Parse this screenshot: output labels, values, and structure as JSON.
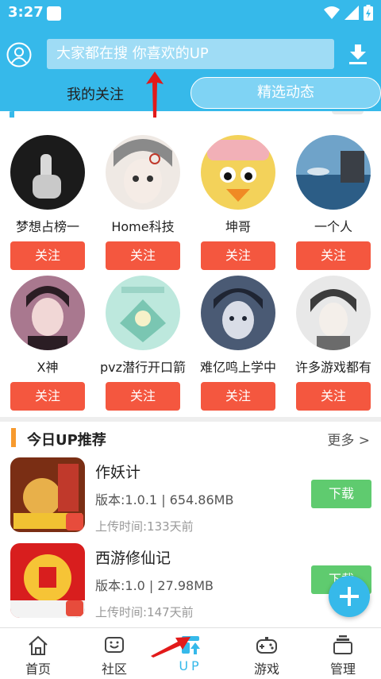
{
  "status_bar": {
    "time": "3:27"
  },
  "header": {
    "search_placeholder": "大家都在搜  你喜欢的UP",
    "tabs": [
      {
        "label": "我的关注"
      },
      {
        "label": "精选动态"
      }
    ]
  },
  "colors": {
    "accent": "#36b9ea",
    "follow": "#f4573f",
    "download": "#5fcb6f",
    "section_bar": "#f79a2e"
  },
  "up_list": {
    "follow_label": "关注",
    "items": [
      {
        "name": "梦想占榜一"
      },
      {
        "name": "Home科技"
      },
      {
        "name": "坤哥"
      },
      {
        "name": "一个人"
      },
      {
        "name": "X神"
      },
      {
        "name": "pvz潜行开口箭"
      },
      {
        "name": "难亿鸣上学中"
      },
      {
        "name": "许多游戏都有"
      }
    ]
  },
  "recommend": {
    "title": "今日UP推荐",
    "more": "更多 >",
    "download_label": "下载",
    "games": [
      {
        "name": "作妖计",
        "meta": "版本:1.0.1 | 654.86MB",
        "time": "上传时间:133天前"
      },
      {
        "name": "西游修仙记",
        "meta": "版本:1.0 | 27.98MB",
        "time": "上传时间:147天前"
      }
    ]
  },
  "bottom_nav": [
    {
      "label": "首页",
      "icon": "home-icon"
    },
    {
      "label": "社区",
      "icon": "community-icon"
    },
    {
      "label": "UP",
      "icon": "up-icon"
    },
    {
      "label": "游戏",
      "icon": "gamepad-icon"
    },
    {
      "label": "管理",
      "icon": "manage-icon"
    }
  ]
}
